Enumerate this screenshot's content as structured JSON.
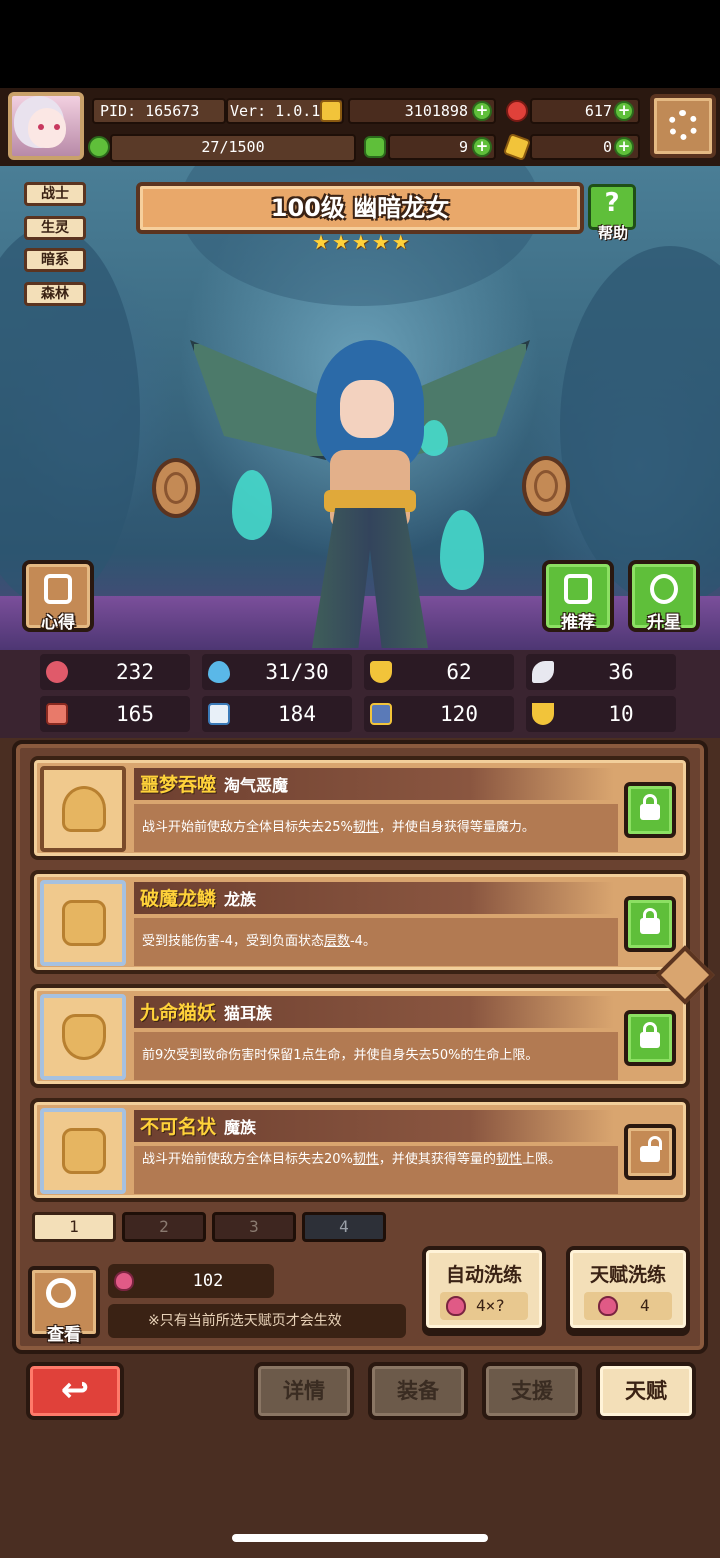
{
  "header": {
    "pid": "PID: 165673",
    "version": "Ver: 1.0.1.0",
    "gold": "3101898",
    "gems": "617",
    "stamina": "27/1500",
    "clover": "9",
    "key": "0"
  },
  "tags": [
    "战士",
    "生灵",
    "暗系",
    "森林"
  ],
  "hero": {
    "title": "100级 幽暗龙女",
    "stars": 5,
    "star_glyphs": [
      "★",
      "★",
      "★",
      "★",
      "★"
    ]
  },
  "buttons": {
    "help": "帮助",
    "notes": "心得",
    "recommend": "推荐",
    "star_up": "升星",
    "view": "查看"
  },
  "stats": {
    "hp": "232",
    "mana": "31/30",
    "defense": "62",
    "speed": "36",
    "attack": "165",
    "magic": "184",
    "armor": "120",
    "luck": "10"
  },
  "talents": [
    {
      "name": "噩梦吞噬",
      "type": "淘气恶魔",
      "desc_pre": "战斗开始前使敌方全体目标失去25%",
      "desc_u": "韧性",
      "desc_post": "，并使自身获得等量魔力。",
      "locked": true
    },
    {
      "name": "破魔龙鳞",
      "type": "龙族",
      "desc_pre": "受到技能伤害-4，受到负面状态",
      "desc_u": "层数",
      "desc_post": "-4。",
      "locked": true
    },
    {
      "name": "九命猫妖",
      "type": "猫耳族",
      "desc_pre": "前9次受到致命伤害时保留1点生命，并使自身失去50%的生命上限。",
      "desc_u": "",
      "desc_post": "",
      "locked": true
    },
    {
      "name": "不可名状",
      "type": "魔族",
      "desc_pre": "战斗开始前使敌方全体目标失去20%",
      "desc_u": "韧性",
      "desc_post": "，并使其获得等量的",
      "desc_u2": "韧性",
      "desc_post2": "上限。",
      "locked": false
    }
  ],
  "pages": [
    "1",
    "2",
    "3",
    "4"
  ],
  "active_page": "1",
  "reroll": {
    "seeds": "102",
    "note": "※只有当前所选天赋页才会生效",
    "auto_label": "自动洗练",
    "auto_cost": "4×?",
    "talent_label": "天赋洗练",
    "talent_cost": "4"
  },
  "nav": {
    "back": "↩",
    "details": "详情",
    "equipment": "装备",
    "support": "支援",
    "talent": "天赋"
  },
  "colors": {
    "panel_brown": "#6a4230",
    "gold_text": "#ffd23a",
    "lock_green": "#5fbf3a",
    "back_red": "#e0413a"
  }
}
